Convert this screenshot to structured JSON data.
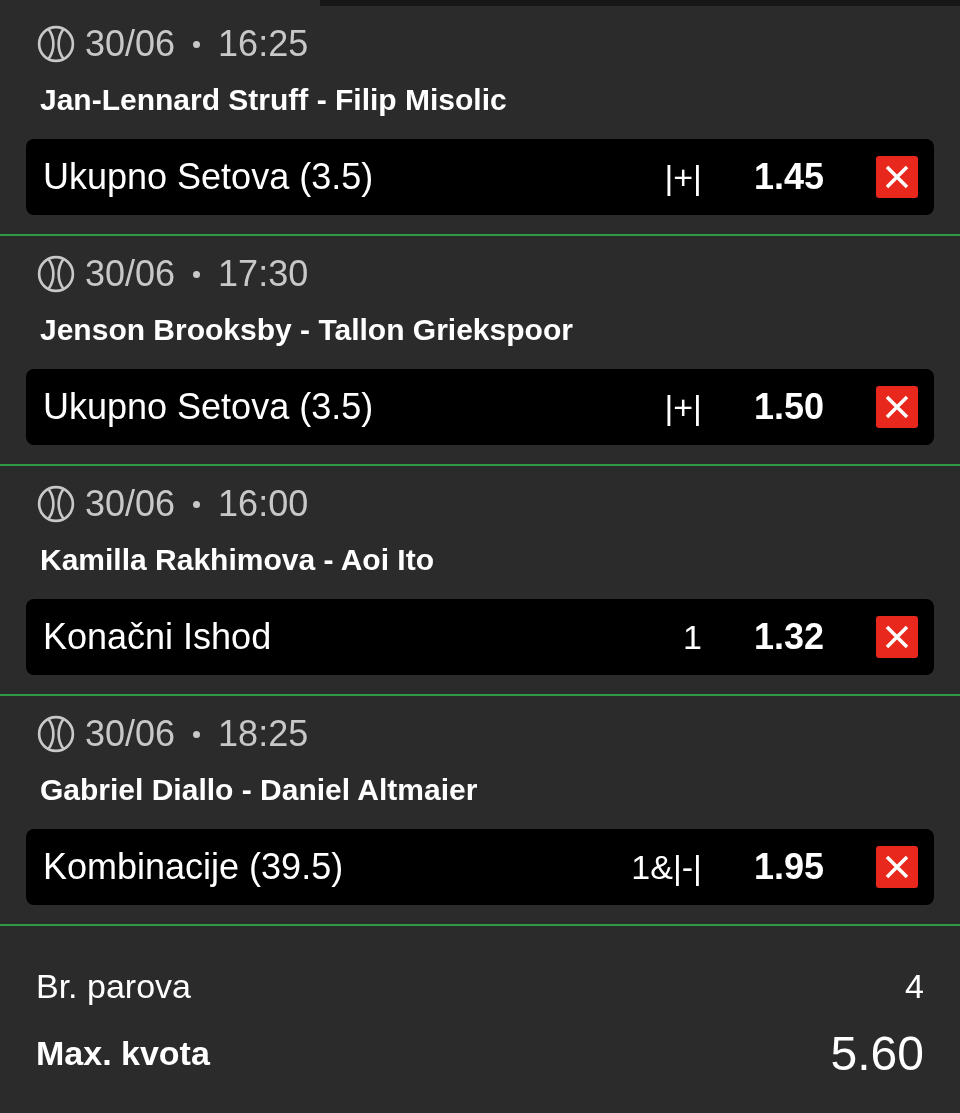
{
  "selections": [
    {
      "date": "30/06",
      "time": "16:25",
      "match": "Jan-Lennard Struff - Filip Misolic",
      "market": "Ukupno Setova (3.5)",
      "pick": "|+|",
      "odds": "1.45"
    },
    {
      "date": "30/06",
      "time": "17:30",
      "match": "Jenson Brooksby - Tallon Griekspoor",
      "market": "Ukupno Setova (3.5)",
      "pick": "|+|",
      "odds": "1.50"
    },
    {
      "date": "30/06",
      "time": "16:00",
      "match": "Kamilla Rakhimova - Aoi Ito",
      "market": "Konačni Ishod",
      "pick": "1",
      "odds": "1.32"
    },
    {
      "date": "30/06",
      "time": "18:25",
      "match": "Gabriel Diallo - Daniel Altmaier",
      "market": "Kombinacije (39.5)",
      "pick": "1&|-|",
      "odds": "1.95"
    }
  ],
  "summary": {
    "pairs_label": "Br. parova",
    "pairs": "4",
    "max_odds_label": "Max. kvota",
    "max_odds": "5.60"
  }
}
